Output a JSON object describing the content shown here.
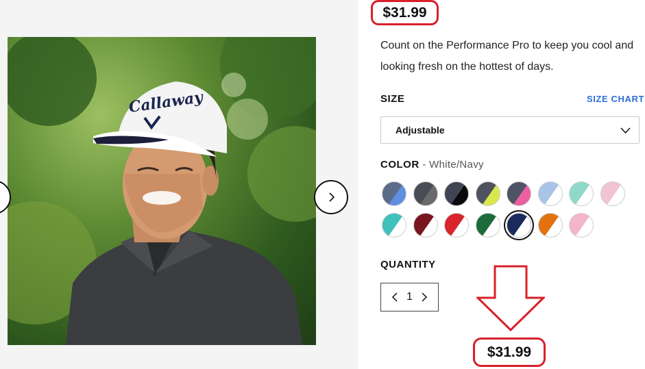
{
  "product": {
    "price_top": "$31.99",
    "description": "Count on the Performance Pro to keep you cool and looking fresh on the hottest of days.",
    "image_alt": "man-wearing-callaway-cap"
  },
  "size": {
    "label": "SIZE",
    "chart_link": "SIZE CHART",
    "selected": "Adjustable"
  },
  "color": {
    "label": "COLOR",
    "selected_name": "- White/Navy",
    "swatches": [
      {
        "c1": "#5b6c8a",
        "c2": "#5f8fe0"
      },
      {
        "c1": "#4a4c55",
        "c2": "#6a6a6a"
      },
      {
        "c1": "#3f4552",
        "c2": "#0a0a0a"
      },
      {
        "c1": "#4f5360",
        "c2": "#d9e84a"
      },
      {
        "c1": "#4f5366",
        "c2": "#ec5fa1"
      },
      {
        "c1": "#a9c4e6",
        "c2": "#ffffff"
      },
      {
        "c1": "#8fd9c9",
        "c2": "#ffffff"
      },
      {
        "c1": "#f2c3d3",
        "c2": "#ffffff"
      },
      {
        "c1": "#3fc0bd",
        "c2": "#ffffff"
      },
      {
        "c1": "#7a1520",
        "c2": "#ffffff"
      },
      {
        "c1": "#d8242b",
        "c2": "#ffffff"
      },
      {
        "c1": "#1e6b3b",
        "c2": "#ffffff"
      },
      {
        "c1": "#1a2a5c",
        "c2": "#ffffff"
      },
      {
        "c1": "#e2720f",
        "c2": "#ffffff"
      },
      {
        "c1": "#f3b6c8",
        "c2": "#ffffff"
      }
    ],
    "selected_index": 12
  },
  "quantity": {
    "label": "QUANTITY",
    "value": "1"
  },
  "annotation": {
    "price_bottom": "$31.99",
    "arrow_icon": "down-arrow-icon",
    "highlight_color": "#d8202a"
  },
  "icons": {
    "prev": "chevron-left-icon",
    "next": "chevron-right-icon",
    "dropdown": "chevron-down-icon"
  },
  "colors": {
    "accent_link": "#2c6fd6",
    "annotation_red": "#d8202a"
  }
}
